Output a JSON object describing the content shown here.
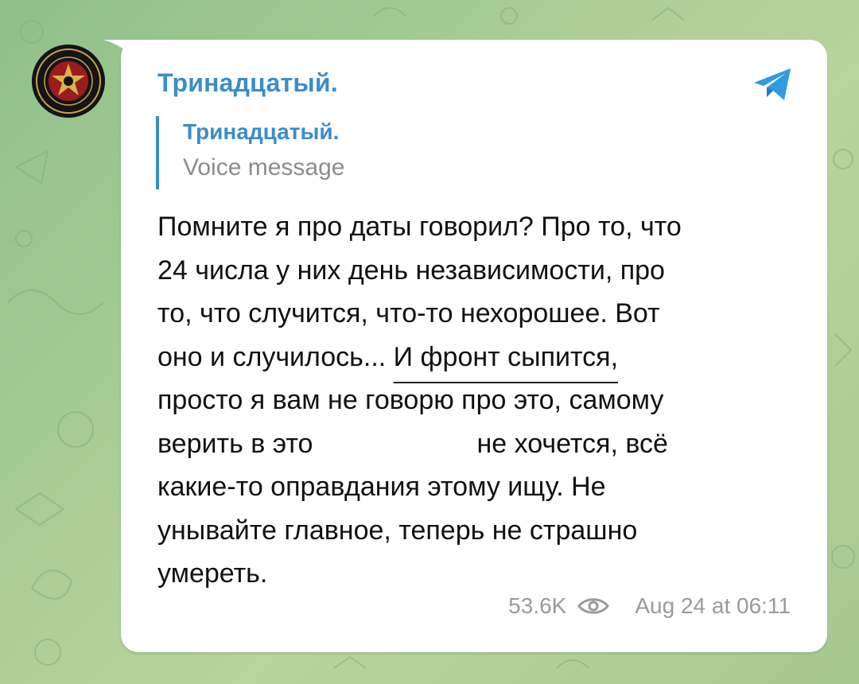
{
  "channel": {
    "name": "Тринадцатый."
  },
  "reply": {
    "author": "Тринадцатый.",
    "text": "Voice message"
  },
  "message": {
    "lines": [
      "Помните я про даты говорил? Про то, что",
      "24 числа у них день независимости, про",
      "то, что случится, что-то нехорошее. Вот",
      "оно и случилось...",
      "И фронт сыпится,",
      "просто я вам не говорю про это, самому",
      "верить в это",
      "не хочется, всё",
      "какие-то оправдания этому ищу. Не",
      "унывайте главное, теперь не страшно",
      "умереть."
    ]
  },
  "meta": {
    "views": "53.6K",
    "timestamp": "Aug 24 at 06:11"
  },
  "icons": {
    "telegram": "telegram-plane-icon",
    "views": "eye-icon",
    "avatar": "channel-emblem"
  },
  "colors": {
    "accent": "#3a8dc9",
    "background": "#a9cc95",
    "bubble": "#ffffff",
    "meta": "#9a9a9a"
  }
}
